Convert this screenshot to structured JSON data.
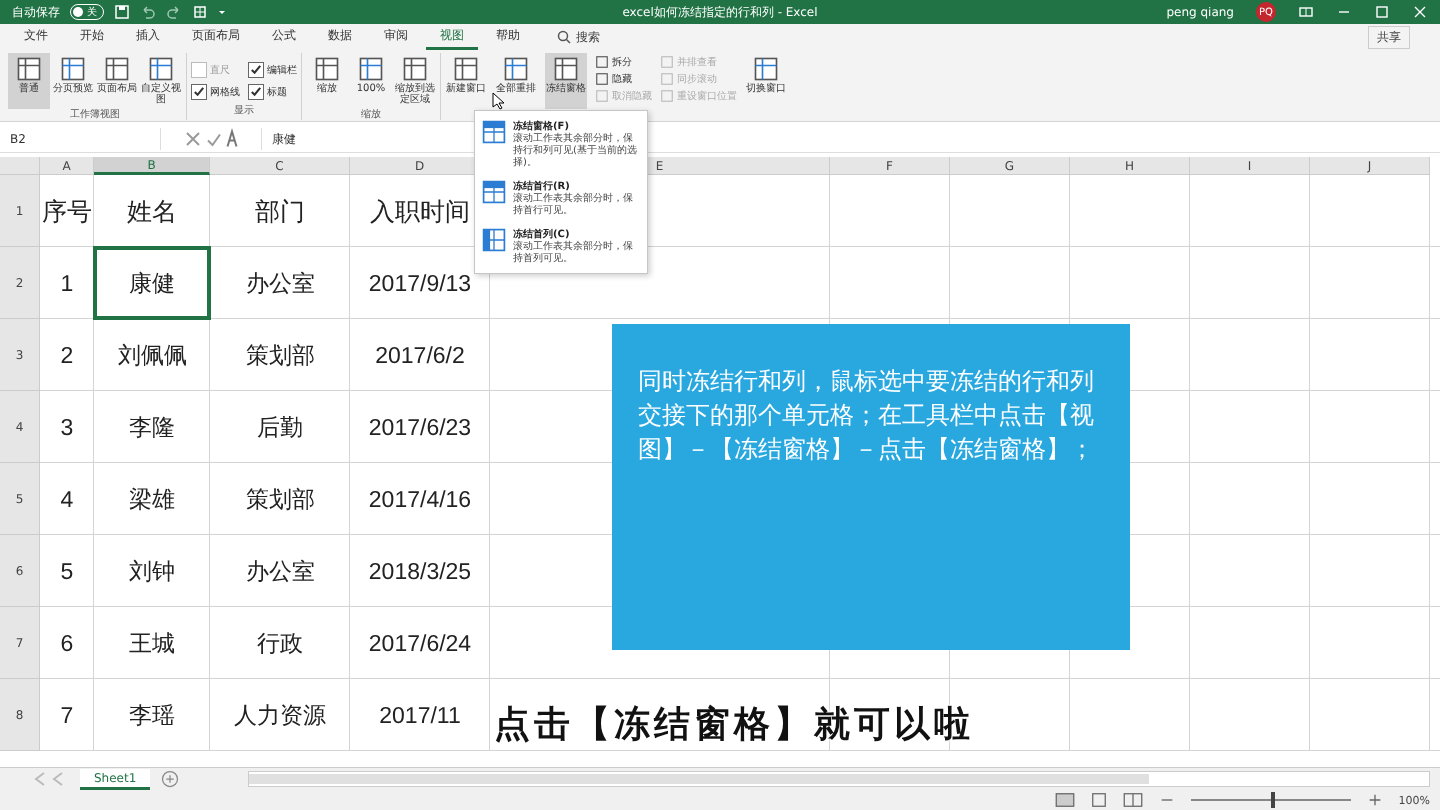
{
  "window": {
    "autosave_label": "自动保存",
    "autosave_state": "关",
    "autosave_on": false,
    "title": "excel如何冻结指定的行和列 - Excel",
    "user": "peng qiang",
    "avatar": "PQ"
  },
  "menu_tabs": [
    {
      "label": "文件",
      "selected": false
    },
    {
      "label": "开始",
      "selected": false
    },
    {
      "label": "插入",
      "selected": false
    },
    {
      "label": "页面布局",
      "selected": false
    },
    {
      "label": "公式",
      "selected": false
    },
    {
      "label": "数据",
      "selected": false
    },
    {
      "label": "审阅",
      "selected": false
    },
    {
      "label": "视图",
      "selected": true
    },
    {
      "label": "帮助",
      "selected": false
    }
  ],
  "search": {
    "placeholder": "搜索"
  },
  "share": "共享",
  "ribbon": [
    {
      "label": "工作簿视图",
      "items": [
        {
          "kind": "large",
          "label": "普通",
          "selected": true
        },
        {
          "kind": "large",
          "label": "分页预览",
          "selected": false
        },
        {
          "kind": "large",
          "label": "页面布局",
          "selected": false
        },
        {
          "kind": "large",
          "label": "自定义视图",
          "selected": false
        }
      ]
    },
    {
      "label": "显示",
      "items": [
        {
          "kind": "check",
          "label": "直尺",
          "checked": false,
          "disabled": true
        },
        {
          "kind": "check",
          "label": "网格线",
          "checked": true,
          "disabled": false
        },
        {
          "kind": "check",
          "label": "编辑栏",
          "checked": true,
          "disabled": false
        },
        {
          "kind": "check",
          "label": "标题",
          "checked": true,
          "disabled": false
        }
      ]
    },
    {
      "label": "缩放",
      "items": [
        {
          "kind": "large",
          "label": "缩放",
          "selected": false
        },
        {
          "kind": "large",
          "label": "100%",
          "selected": false
        },
        {
          "kind": "large",
          "label": "缩放到选定区域",
          "selected": false
        }
      ]
    },
    {
      "items": [
        {
          "kind": "large",
          "label": "新建窗口",
          "selected": false
        },
        {
          "kind": "large",
          "label": "全部重排",
          "selected": false
        },
        {
          "kind": "large",
          "label": "冻结窗格",
          "selected": true
        },
        {
          "kind": "small",
          "label": "拆分",
          "disabled": false
        },
        {
          "kind": "small",
          "label": "隐藏",
          "disabled": false
        },
        {
          "kind": "small",
          "label": "取消隐藏",
          "disabled": true
        },
        {
          "kind": "small",
          "label": "并排查看",
          "disabled": true
        },
        {
          "kind": "small",
          "label": "同步滚动",
          "disabled": true
        },
        {
          "kind": "small",
          "label": "重设窗口位置",
          "disabled": true
        },
        {
          "kind": "large",
          "label": "切换窗口",
          "selected": false
        }
      ]
    }
  ],
  "freeze_menu": [
    {
      "title": "冻结窗格(F)",
      "description": "滚动工作表其余部分时，保持行和列可见(基于当前的选择)。"
    },
    {
      "title": "冻结首行(R)",
      "description": "滚动工作表其余部分时，保持首行可见。"
    },
    {
      "title": "冻结首列(C)",
      "description": "滚动工作表其余部分时，保持首列可见。"
    }
  ],
  "formula_bar": {
    "name_box": "B2",
    "value": "康健"
  },
  "sheet": {
    "columns": [
      {
        "label": "A",
        "selected": false
      },
      {
        "label": "B",
        "selected": true
      },
      {
        "label": "C",
        "selected": false
      },
      {
        "label": "D",
        "selected": false
      },
      {
        "label": "E",
        "selected": false
      },
      {
        "label": "F",
        "selected": false
      },
      {
        "label": "G",
        "selected": false
      },
      {
        "label": "H",
        "selected": false
      },
      {
        "label": "I",
        "selected": false
      },
      {
        "label": "J",
        "selected": false
      }
    ],
    "row_numbers": [
      "1",
      "2",
      "3",
      "4",
      "5",
      "6",
      "7",
      "8"
    ],
    "rows": [
      {
        "cells": [
          {
            "text": "序号",
            "selected": false
          },
          {
            "text": "姓名",
            "selected": false
          },
          {
            "text": "部门",
            "selected": false
          },
          {
            "text": "入职时间",
            "selected": false
          }
        ]
      },
      {
        "cells": [
          {
            "text": "1",
            "selected": false
          },
          {
            "text": "康健",
            "selected": true
          },
          {
            "text": "办公室",
            "selected": false
          },
          {
            "text": "2017/9/13",
            "selected": false
          }
        ]
      },
      {
        "cells": [
          {
            "text": "2",
            "selected": false
          },
          {
            "text": "刘佩佩",
            "selected": false
          },
          {
            "text": "策划部",
            "selected": false
          },
          {
            "text": "2017/6/2",
            "selected": false
          }
        ]
      },
      {
        "cells": [
          {
            "text": "3",
            "selected": false
          },
          {
            "text": "李隆",
            "selected": false
          },
          {
            "text": "后勤",
            "selected": false
          },
          {
            "text": "2017/6/23",
            "selected": false
          }
        ]
      },
      {
        "cells": [
          {
            "text": "4",
            "selected": false
          },
          {
            "text": "梁雄",
            "selected": false
          },
          {
            "text": "策划部",
            "selected": false
          },
          {
            "text": "2017/4/16",
            "selected": false
          }
        ]
      },
      {
        "cells": [
          {
            "text": "5",
            "selected": false
          },
          {
            "text": "刘钟",
            "selected": false
          },
          {
            "text": "办公室",
            "selected": false
          },
          {
            "text": "2018/3/25",
            "selected": false
          }
        ]
      },
      {
        "cells": [
          {
            "text": "6",
            "selected": false
          },
          {
            "text": "王城",
            "selected": false
          },
          {
            "text": "行政",
            "selected": false
          },
          {
            "text": "2017/6/24",
            "selected": false
          }
        ]
      },
      {
        "cells": [
          {
            "text": "7",
            "selected": false
          },
          {
            "text": "李瑶",
            "selected": false
          },
          {
            "text": "人力资源",
            "selected": false
          },
          {
            "text": "2017/11",
            "selected": false
          }
        ]
      }
    ]
  },
  "note": "同时冻结行和列，鼠标选中要冻结的行和列交接下的那个单元格；在工具栏中点击【视图】－【冻结窗格】－点击【冻结窗格】；",
  "caption": "点击【冻结窗格】就可以啦",
  "sheet_tabs": [
    {
      "label": "Sheet1",
      "selected": true
    }
  ],
  "status_bar": {
    "zoom": "100%",
    "zoom_slider": {
      "level": 0.5
    }
  }
}
